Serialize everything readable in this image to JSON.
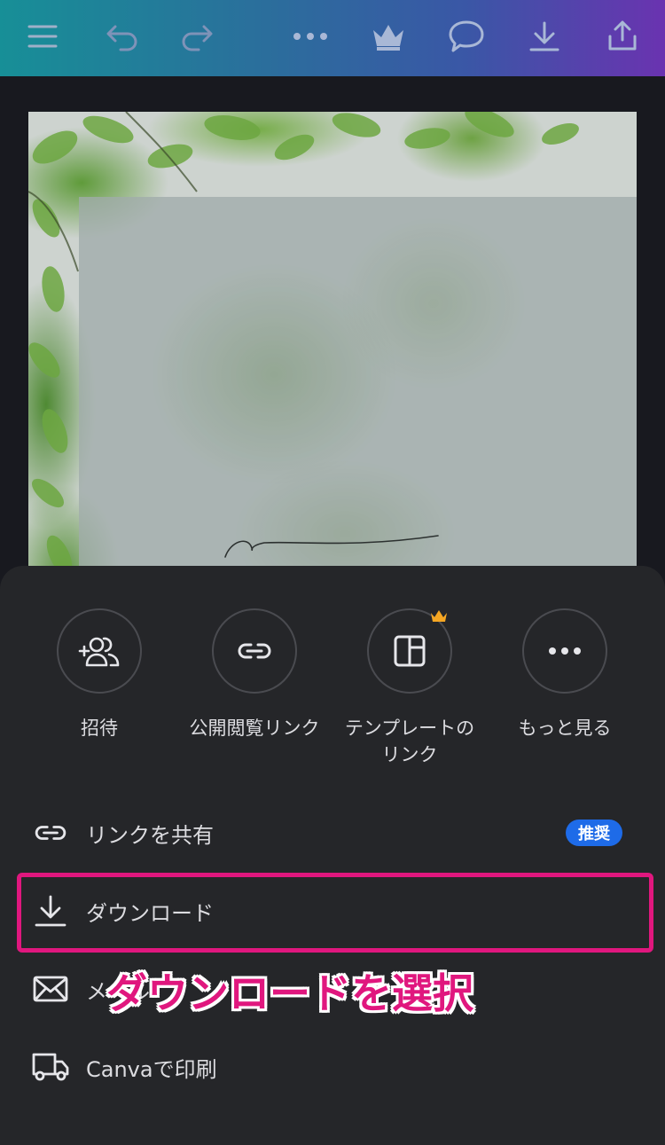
{
  "toolbar": {
    "icons": [
      "menu-icon",
      "undo-icon",
      "redo-icon",
      "more-icon",
      "crown-icon",
      "comment-icon",
      "download-icon",
      "share-icon"
    ]
  },
  "share_options": [
    {
      "label": "招待",
      "icon": "invite-people-icon"
    },
    {
      "label": "公開閲覧リンク",
      "icon": "link-icon"
    },
    {
      "label": "テンプレートの\nリンク",
      "icon": "template-icon",
      "premium": true
    },
    {
      "label": "もっと見る",
      "icon": "more-icon"
    }
  ],
  "list": {
    "share_link": {
      "label": "リンクを共有",
      "badge": "推奨",
      "icon": "link-icon"
    },
    "download": {
      "label": "ダウンロード",
      "icon": "download-icon"
    },
    "email": {
      "label": "メール",
      "icon": "mail-icon"
    },
    "print": {
      "label": "Canvaで印刷",
      "icon": "truck-icon"
    }
  },
  "annotation": {
    "callout": "ダウンロードを選択",
    "highlight_color": "#e0177e"
  },
  "colors": {
    "sheet_bg": "#252629",
    "badge_bg": "#1e6be8",
    "crown": "#f5a623"
  }
}
